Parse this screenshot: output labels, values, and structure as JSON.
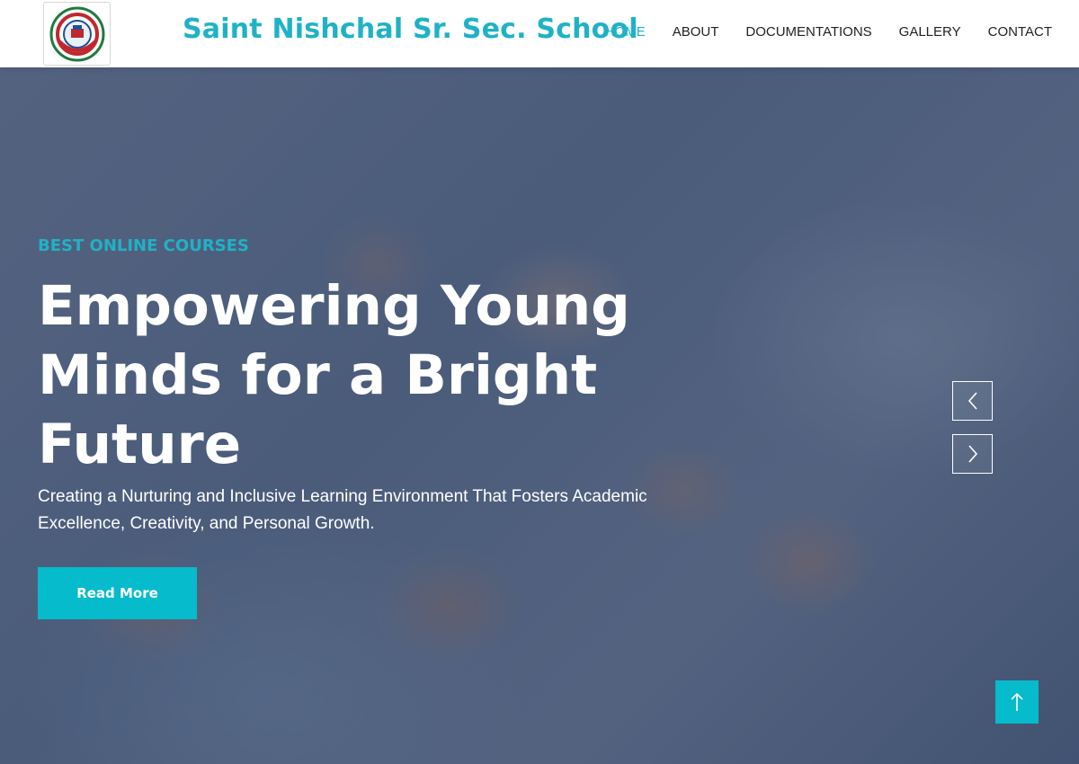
{
  "header": {
    "logo_icon": "school-crest-logo",
    "title": "Saint Nishchal Sr. Sec. School",
    "nav": [
      {
        "label": "HOME",
        "active": true
      },
      {
        "label": "ABOUT",
        "active": false
      },
      {
        "label": "DOCUMENTATIONS",
        "active": false
      },
      {
        "label": "GALLERY",
        "active": false
      },
      {
        "label": "CONTACT",
        "active": false
      }
    ]
  },
  "hero": {
    "background_icon": "students-group-photo",
    "eyebrow": "BEST ONLINE COURSES",
    "headline": "Empowering Young Minds for a Bright Future",
    "subtext": "Creating a Nurturing and Inclusive Learning Environment That Fosters Academic Excellence, Creativity, and Personal Growth.",
    "button_label": "Read More",
    "prev_icon": "chevron-left-icon",
    "next_icon": "chevron-right-icon"
  },
  "back_to_top_icon": "arrow-up-icon",
  "colors": {
    "accent": "#06bbcc",
    "brand_text": "#1fb2c6",
    "nav_text": "#222222",
    "hero_text": "#ffffff"
  }
}
